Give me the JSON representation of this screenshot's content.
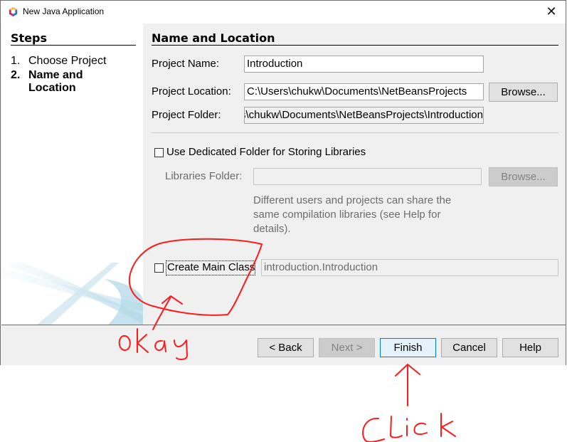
{
  "window": {
    "title": "New Java Application",
    "app_icon": "netbeans-cube-icon",
    "close_icon": "close-icon"
  },
  "sidebar": {
    "title": "Steps",
    "steps": [
      {
        "number": "1.",
        "label": "Choose Project",
        "current": false
      },
      {
        "number": "2.",
        "label_line1": "Name and",
        "label_line2": "Location",
        "current": true
      }
    ]
  },
  "main": {
    "title": "Name and Location",
    "project_name": {
      "label": "Project Name:",
      "value": "Introduction"
    },
    "project_location": {
      "label": "Project Location:",
      "value": "C:\\Users\\chukw\\Documents\\NetBeansProjects",
      "browse_label": "Browse..."
    },
    "project_folder": {
      "label": "Project Folder:",
      "value": "C:\\Users\\chukw\\Documents\\NetBeansProjects\\Introduction"
    },
    "dedicated_folder": {
      "label": "Use Dedicated Folder for Storing Libraries",
      "checked": false
    },
    "libraries_folder": {
      "label": "Libraries Folder:",
      "value": "",
      "browse_label": "Browse..."
    },
    "help_text": "Different users and projects can share the same compilation libraries (see Help for details).",
    "create_main_class": {
      "label": "Create Main Class",
      "checked": false,
      "value": "introduction.Introduction"
    }
  },
  "footer": {
    "back_label": "< Back",
    "next_label": "Next >",
    "finish_label": "Finish",
    "cancel_label": "Cancel",
    "help_label": "Help"
  },
  "annotations": {
    "okay_text": "Okay",
    "click_text": "Click",
    "color": "#ff1a1a"
  }
}
